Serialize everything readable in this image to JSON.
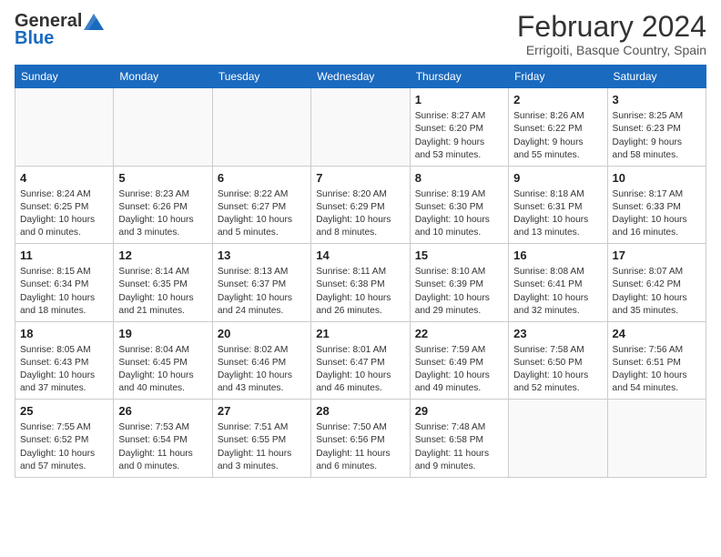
{
  "logo": {
    "general": "General",
    "blue": "Blue"
  },
  "title": "February 2024",
  "subtitle": "Errigoiti, Basque Country, Spain",
  "days_of_week": [
    "Sunday",
    "Monday",
    "Tuesday",
    "Wednesday",
    "Thursday",
    "Friday",
    "Saturday"
  ],
  "weeks": [
    [
      {
        "day": "",
        "info": ""
      },
      {
        "day": "",
        "info": ""
      },
      {
        "day": "",
        "info": ""
      },
      {
        "day": "",
        "info": ""
      },
      {
        "day": "1",
        "info": "Sunrise: 8:27 AM\nSunset: 6:20 PM\nDaylight: 9 hours\nand 53 minutes."
      },
      {
        "day": "2",
        "info": "Sunrise: 8:26 AM\nSunset: 6:22 PM\nDaylight: 9 hours\nand 55 minutes."
      },
      {
        "day": "3",
        "info": "Sunrise: 8:25 AM\nSunset: 6:23 PM\nDaylight: 9 hours\nand 58 minutes."
      }
    ],
    [
      {
        "day": "4",
        "info": "Sunrise: 8:24 AM\nSunset: 6:25 PM\nDaylight: 10 hours\nand 0 minutes."
      },
      {
        "day": "5",
        "info": "Sunrise: 8:23 AM\nSunset: 6:26 PM\nDaylight: 10 hours\nand 3 minutes."
      },
      {
        "day": "6",
        "info": "Sunrise: 8:22 AM\nSunset: 6:27 PM\nDaylight: 10 hours\nand 5 minutes."
      },
      {
        "day": "7",
        "info": "Sunrise: 8:20 AM\nSunset: 6:29 PM\nDaylight: 10 hours\nand 8 minutes."
      },
      {
        "day": "8",
        "info": "Sunrise: 8:19 AM\nSunset: 6:30 PM\nDaylight: 10 hours\nand 10 minutes."
      },
      {
        "day": "9",
        "info": "Sunrise: 8:18 AM\nSunset: 6:31 PM\nDaylight: 10 hours\nand 13 minutes."
      },
      {
        "day": "10",
        "info": "Sunrise: 8:17 AM\nSunset: 6:33 PM\nDaylight: 10 hours\nand 16 minutes."
      }
    ],
    [
      {
        "day": "11",
        "info": "Sunrise: 8:15 AM\nSunset: 6:34 PM\nDaylight: 10 hours\nand 18 minutes."
      },
      {
        "day": "12",
        "info": "Sunrise: 8:14 AM\nSunset: 6:35 PM\nDaylight: 10 hours\nand 21 minutes."
      },
      {
        "day": "13",
        "info": "Sunrise: 8:13 AM\nSunset: 6:37 PM\nDaylight: 10 hours\nand 24 minutes."
      },
      {
        "day": "14",
        "info": "Sunrise: 8:11 AM\nSunset: 6:38 PM\nDaylight: 10 hours\nand 26 minutes."
      },
      {
        "day": "15",
        "info": "Sunrise: 8:10 AM\nSunset: 6:39 PM\nDaylight: 10 hours\nand 29 minutes."
      },
      {
        "day": "16",
        "info": "Sunrise: 8:08 AM\nSunset: 6:41 PM\nDaylight: 10 hours\nand 32 minutes."
      },
      {
        "day": "17",
        "info": "Sunrise: 8:07 AM\nSunset: 6:42 PM\nDaylight: 10 hours\nand 35 minutes."
      }
    ],
    [
      {
        "day": "18",
        "info": "Sunrise: 8:05 AM\nSunset: 6:43 PM\nDaylight: 10 hours\nand 37 minutes."
      },
      {
        "day": "19",
        "info": "Sunrise: 8:04 AM\nSunset: 6:45 PM\nDaylight: 10 hours\nand 40 minutes."
      },
      {
        "day": "20",
        "info": "Sunrise: 8:02 AM\nSunset: 6:46 PM\nDaylight: 10 hours\nand 43 minutes."
      },
      {
        "day": "21",
        "info": "Sunrise: 8:01 AM\nSunset: 6:47 PM\nDaylight: 10 hours\nand 46 minutes."
      },
      {
        "day": "22",
        "info": "Sunrise: 7:59 AM\nSunset: 6:49 PM\nDaylight: 10 hours\nand 49 minutes."
      },
      {
        "day": "23",
        "info": "Sunrise: 7:58 AM\nSunset: 6:50 PM\nDaylight: 10 hours\nand 52 minutes."
      },
      {
        "day": "24",
        "info": "Sunrise: 7:56 AM\nSunset: 6:51 PM\nDaylight: 10 hours\nand 54 minutes."
      }
    ],
    [
      {
        "day": "25",
        "info": "Sunrise: 7:55 AM\nSunset: 6:52 PM\nDaylight: 10 hours\nand 57 minutes."
      },
      {
        "day": "26",
        "info": "Sunrise: 7:53 AM\nSunset: 6:54 PM\nDaylight: 11 hours\nand 0 minutes."
      },
      {
        "day": "27",
        "info": "Sunrise: 7:51 AM\nSunset: 6:55 PM\nDaylight: 11 hours\nand 3 minutes."
      },
      {
        "day": "28",
        "info": "Sunrise: 7:50 AM\nSunset: 6:56 PM\nDaylight: 11 hours\nand 6 minutes."
      },
      {
        "day": "29",
        "info": "Sunrise: 7:48 AM\nSunset: 6:58 PM\nDaylight: 11 hours\nand 9 minutes."
      },
      {
        "day": "",
        "info": ""
      },
      {
        "day": "",
        "info": ""
      }
    ]
  ]
}
